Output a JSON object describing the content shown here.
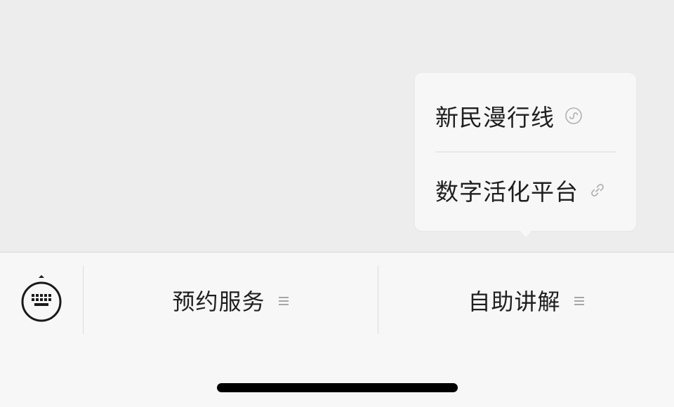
{
  "popup_menu": {
    "items": [
      {
        "label": "新民漫行线",
        "icon": "mini-program-icon"
      },
      {
        "label": "数字活化平台",
        "icon": "link-icon"
      }
    ]
  },
  "bottom_menu": {
    "keyboard_icon": "keyboard-icon",
    "buttons": [
      {
        "label": "预约服务",
        "icon": "submenu-lines-icon"
      },
      {
        "label": "自助讲解",
        "icon": "submenu-lines-icon"
      }
    ]
  },
  "colors": {
    "background": "#ededed",
    "bar": "#f7f7f7",
    "text": "#1f1f1f",
    "icon_gray": "#b0b0b0"
  }
}
